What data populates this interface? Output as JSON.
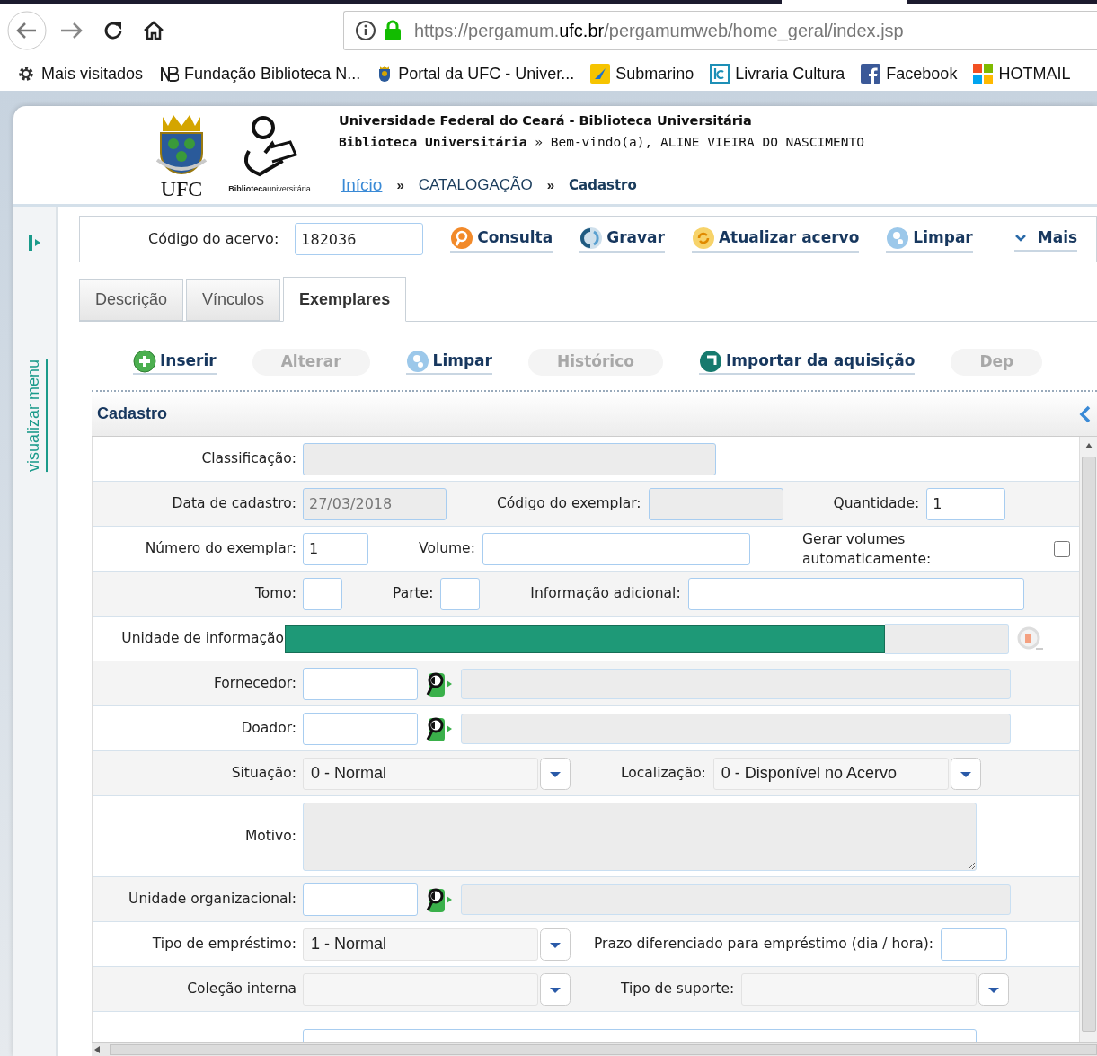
{
  "browser": {
    "url": {
      "host_prefix": "https://pergamum.",
      "host": "ufc.br",
      "path": "/pergamumweb/home_geral/index.jsp"
    },
    "bookmarks": [
      {
        "label": "Mais visitados",
        "kind": "gear"
      },
      {
        "label": "Fundação Biblioteca N...",
        "kind": "monogram"
      },
      {
        "label": "Portal da UFC - Univer...",
        "kind": "crest"
      },
      {
        "label": "Submarino",
        "kind": "yellow"
      },
      {
        "label": "Livraria Cultura",
        "kind": "lc"
      },
      {
        "label": "Facebook",
        "kind": "fb"
      },
      {
        "label": "HOTMAIL",
        "kind": "windows"
      }
    ]
  },
  "header": {
    "logo_text": "UFC",
    "library_logo_text": "**Biblioteca**universitária",
    "title": "Universidade Federal do Ceará - Biblioteca Universitária",
    "welcome": "**Biblioteca Universitária** » Bem-vindo(a), ALINE VIEIRA DO NASCIMENTO",
    "breadcrumb": [
      {
        "label": "Início",
        "kind": "link"
      },
      {
        "label": "»",
        "kind": "sep"
      },
      {
        "label": "CATALOGAÇÃO",
        "kind": "text"
      },
      {
        "label": "»",
        "kind": "sep"
      },
      {
        "label": "Cadastro",
        "kind": "current"
      }
    ]
  },
  "sidebar": {
    "label": "visualizar menu"
  },
  "toolbar": {
    "label": "Código do acervo:",
    "value": "182036",
    "buttons": [
      {
        "label": "Consulta",
        "kind": "search"
      },
      {
        "label": "Gravar",
        "kind": "save"
      },
      {
        "label": "Atualizar acervo",
        "kind": "refresh"
      },
      {
        "label": "Limpar",
        "kind": "clear"
      },
      {
        "label": "Mais",
        "kind": "more"
      }
    ]
  },
  "tabs": [
    {
      "label": "Descrição",
      "selected": false
    },
    {
      "label": "Vínculos",
      "selected": false
    },
    {
      "label": "Exemplares",
      "selected": true
    }
  ],
  "actions": [
    {
      "label": "Inserir",
      "kind": "add",
      "disabled": false
    },
    {
      "label": "Alterar",
      "kind": "none",
      "disabled": true
    },
    {
      "label": "Limpar",
      "kind": "clear",
      "disabled": false
    },
    {
      "label": "Histórico",
      "kind": "none",
      "disabled": true
    },
    {
      "label": "Importar da aquisição",
      "kind": "import",
      "disabled": false
    },
    {
      "label": "Dep",
      "kind": "none",
      "disabled": true
    }
  ],
  "panel": {
    "title": "Cadastro",
    "rows": [
      {
        "fields": [
          {
            "label": "Classificação:",
            "kind": "text",
            "disabled": true
          }
        ]
      },
      {
        "fields": [
          {
            "label": "Data de cadastro:",
            "kind": "text",
            "value": "27/03/2018",
            "disabled": true
          },
          {
            "label": "Código do exemplar:",
            "kind": "text",
            "disabled": true
          },
          {
            "label": "Quantidade:",
            "kind": "text",
            "value": "1",
            "disabled": false
          }
        ]
      },
      {
        "fields": [
          {
            "label": "Número do exemplar:",
            "kind": "text",
            "value": "1",
            "disabled": false,
            "focused": true
          },
          {
            "label": "Volume:",
            "kind": "text",
            "disabled": false
          },
          {
            "label": "Gerar volumes automaticamente:",
            "kind": "checkbox",
            "checked": false
          }
        ]
      },
      {
        "fields": [
          {
            "label": "Tomo:",
            "kind": "text",
            "disabled": false
          },
          {
            "label": "Parte:",
            "kind": "text",
            "disabled": false
          },
          {
            "label": "Informação adicional:",
            "kind": "text",
            "disabled": false
          }
        ]
      },
      {
        "fields": [
          {
            "label": "Unidade de informação",
            "kind": "lookup",
            "redacted": true
          }
        ]
      },
      {
        "fields": [
          {
            "label": "Fornecedor:",
            "kind": "lookup",
            "redacted": false
          }
        ]
      },
      {
        "fields": [
          {
            "label": "Doador:",
            "kind": "lookup",
            "redacted": false
          }
        ]
      },
      {
        "fields": [
          {
            "label": "Situação:",
            "kind": "select",
            "value": "0 - Normal"
          },
          {
            "label": "Localização:",
            "kind": "select",
            "value": "0 - Disponível no Acervo"
          }
        ]
      },
      {
        "fields": [
          {
            "label": "Motivo:",
            "kind": "textarea",
            "disabled": true
          }
        ]
      },
      {
        "fields": [
          {
            "label": "Unidade organizacional:",
            "kind": "lookup",
            "redacted": false
          }
        ]
      },
      {
        "fields": [
          {
            "label": "Tipo de empréstimo:",
            "kind": "select",
            "value": "1 - Normal"
          },
          {
            "label": "Prazo diferenciado para empréstimo (dia / hora):",
            "kind": "text",
            "disabled": false
          }
        ]
      },
      {
        "fields": [
          {
            "label": "Coleção interna",
            "kind": "select"
          },
          {
            "label": "Tipo de suporte:",
            "kind": "select"
          }
        ]
      },
      {
        "fields": [
          {
            "kind": "partial"
          }
        ]
      }
    ]
  }
}
